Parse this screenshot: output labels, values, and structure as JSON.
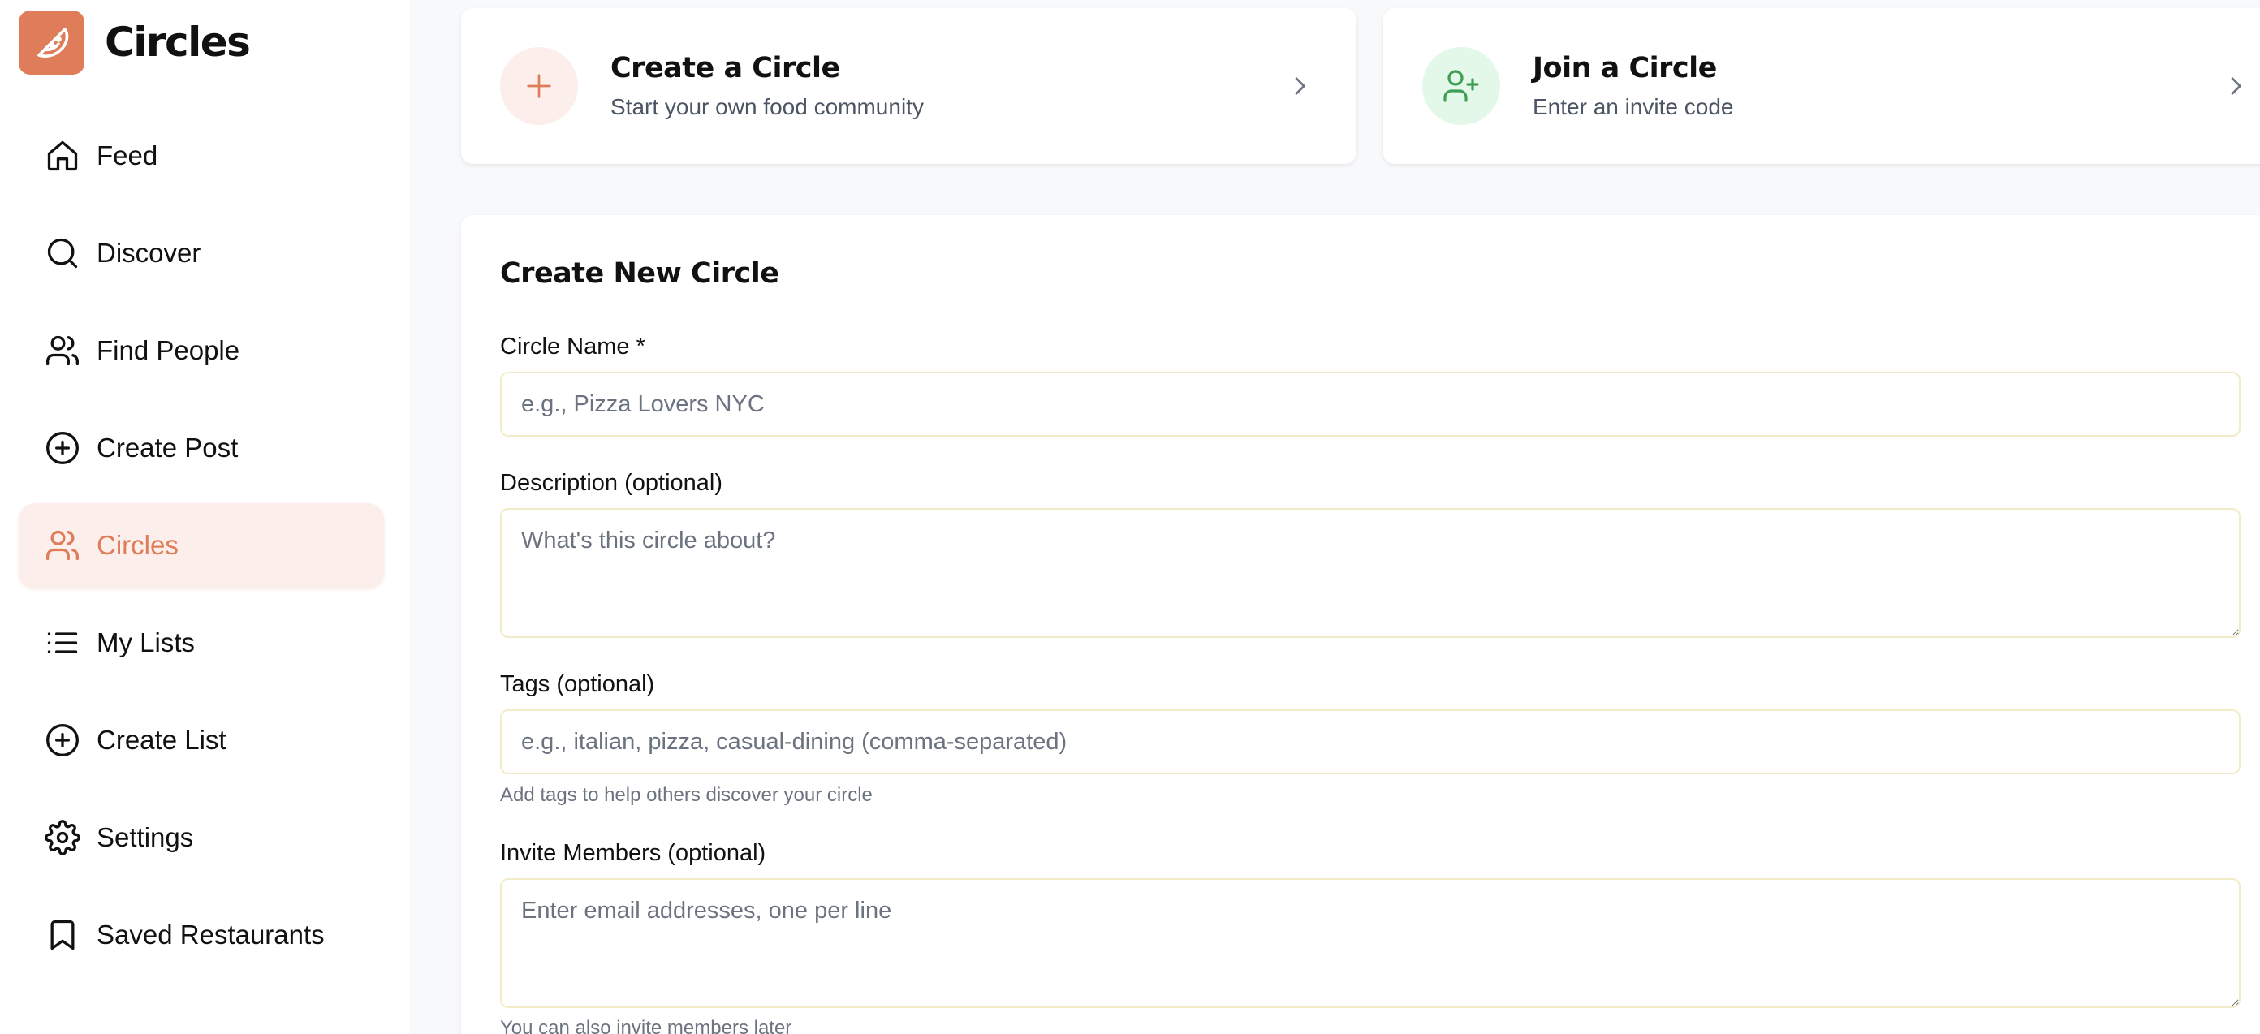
{
  "brand": {
    "name": "Circles",
    "logo_icon": "pizza-slice-icon",
    "accent": "#df7d5a"
  },
  "sidebar": {
    "items": [
      {
        "label": "Feed",
        "icon": "home-icon",
        "active": false
      },
      {
        "label": "Discover",
        "icon": "search-icon",
        "active": false
      },
      {
        "label": "Find People",
        "icon": "users-icon",
        "active": false
      },
      {
        "label": "Create Post",
        "icon": "plus-circle-icon",
        "active": false
      },
      {
        "label": "Circles",
        "icon": "users-icon",
        "active": true
      },
      {
        "label": "My Lists",
        "icon": "list-icon",
        "active": false
      },
      {
        "label": "Create List",
        "icon": "plus-circle-icon",
        "active": false
      },
      {
        "label": "Settings",
        "icon": "gear-icon",
        "active": false
      },
      {
        "label": "Saved Restaurants",
        "icon": "bookmark-icon",
        "active": false
      }
    ]
  },
  "actions": {
    "create": {
      "title": "Create a Circle",
      "subtitle": "Start your own food community",
      "icon": "plus-icon",
      "icon_bg": "#fcefeb",
      "icon_color": "#df7d5a"
    },
    "join": {
      "title": "Join a Circle",
      "subtitle": "Enter an invite code",
      "icon": "user-plus-icon",
      "icon_bg": "#e3f8e8",
      "icon_color": "#3f9e55"
    }
  },
  "form": {
    "title": "Create New Circle",
    "name": {
      "label": "Circle Name *",
      "placeholder": "e.g., Pizza Lovers NYC",
      "value": ""
    },
    "description": {
      "label": "Description (optional)",
      "placeholder": "What's this circle about?",
      "value": ""
    },
    "tags": {
      "label": "Tags (optional)",
      "placeholder": "e.g., italian, pizza, casual-dining (comma-separated)",
      "value": "",
      "hint": "Add tags to help others discover your circle"
    },
    "invite": {
      "label": "Invite Members (optional)",
      "placeholder": "Enter email addresses, one per line",
      "value": "",
      "hint": "You can also invite members later"
    }
  }
}
